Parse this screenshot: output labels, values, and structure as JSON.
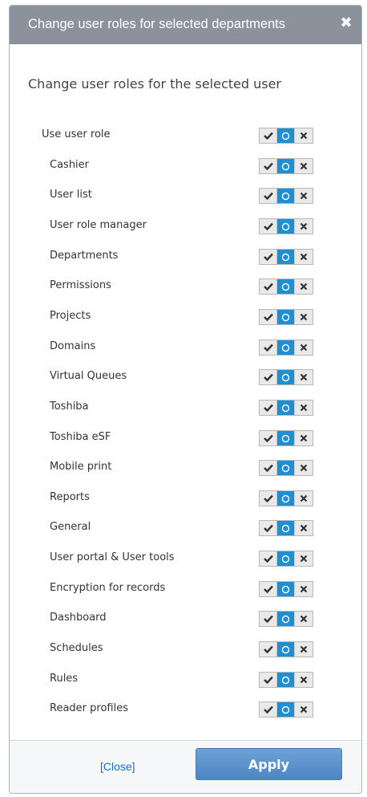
{
  "dialog": {
    "title": "Change user roles for selected departments",
    "close_icon": "✖",
    "heading": "Change user roles for the selected user"
  },
  "roles": {
    "parent": {
      "label": "Use user role",
      "state": "inherit"
    },
    "items": [
      {
        "label": "Cashier",
        "state": "inherit"
      },
      {
        "label": "User list",
        "state": "inherit"
      },
      {
        "label": "User role manager",
        "state": "inherit"
      },
      {
        "label": "Departments",
        "state": "inherit"
      },
      {
        "label": "Permissions",
        "state": "inherit"
      },
      {
        "label": "Projects",
        "state": "inherit"
      },
      {
        "label": "Domains",
        "state": "inherit"
      },
      {
        "label": "Virtual Queues",
        "state": "inherit"
      },
      {
        "label": "Toshiba",
        "state": "inherit"
      },
      {
        "label": "Toshiba eSF",
        "state": "inherit"
      },
      {
        "label": "Mobile print",
        "state": "inherit"
      },
      {
        "label": "Reports",
        "state": "inherit"
      },
      {
        "label": "General",
        "state": "inherit"
      },
      {
        "label": "User portal & User tools",
        "state": "inherit"
      },
      {
        "label": "Encryption for records",
        "state": "inherit"
      },
      {
        "label": "Dashboard",
        "state": "inherit"
      },
      {
        "label": "Schedules",
        "state": "inherit"
      },
      {
        "label": "Rules",
        "state": "inherit"
      },
      {
        "label": "Reader profiles",
        "state": "inherit"
      }
    ]
  },
  "toggle_icons": {
    "allow": "check-icon",
    "inherit": "circle-icon",
    "deny": "x-icon"
  },
  "footer": {
    "close_label": "[Close]",
    "apply_label": "Apply"
  },
  "colors": {
    "titlebar": "#8b929c",
    "selected": "#1e8fd2",
    "apply": "#5b90c9",
    "link": "#1d6fb8"
  }
}
